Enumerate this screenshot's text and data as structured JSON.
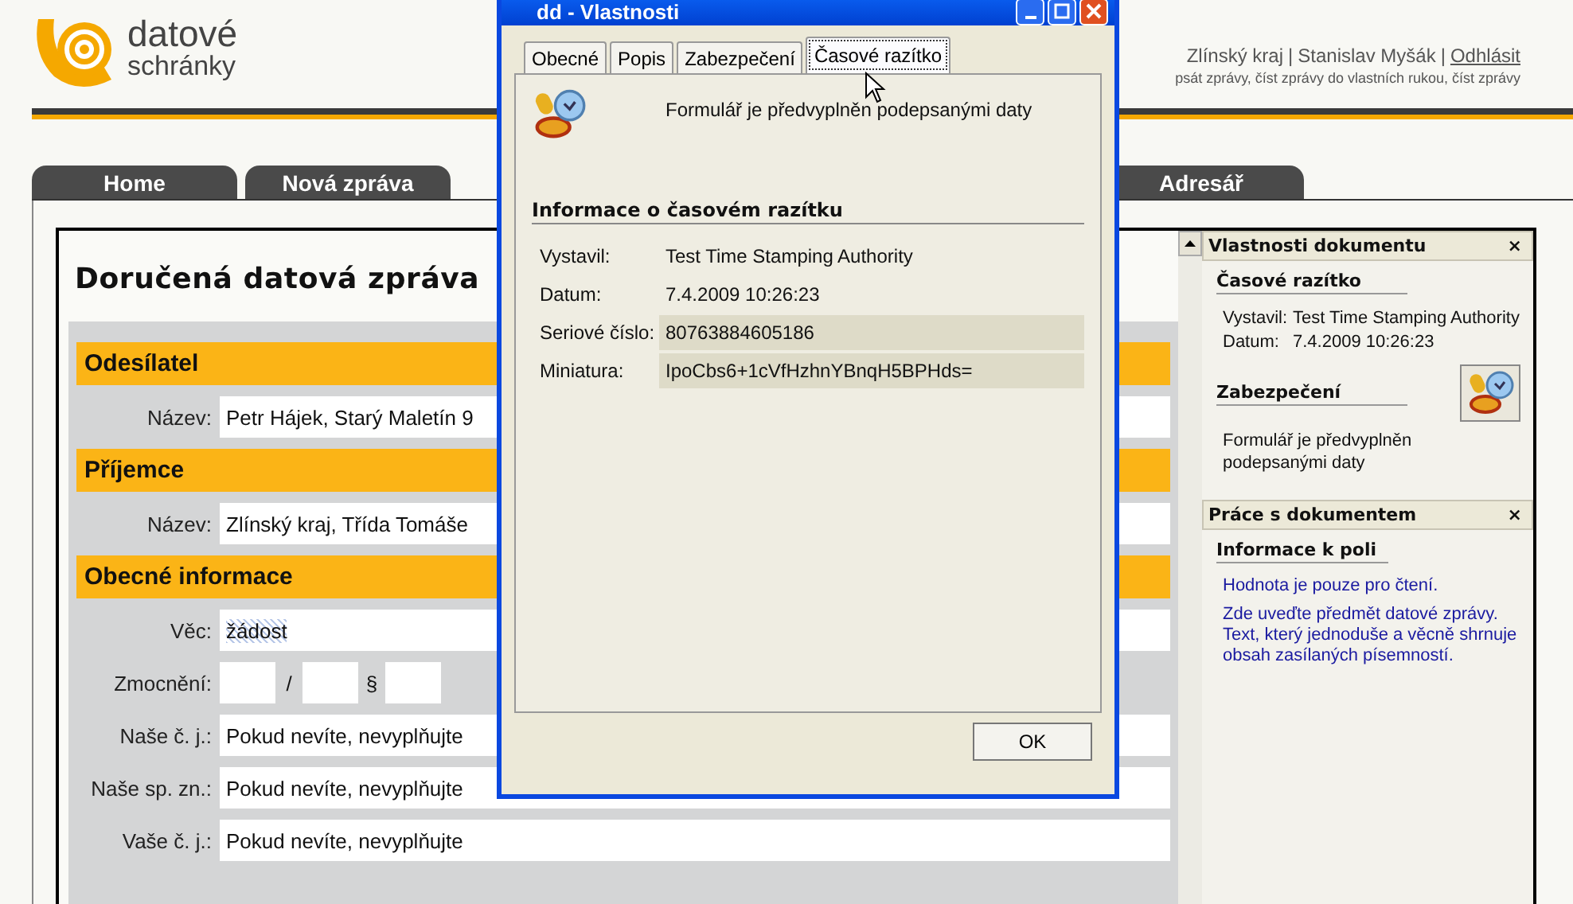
{
  "header": {
    "logo": {
      "line_1": "datové",
      "line_2": "schránky"
    },
    "user_bar": [
      {
        "kind": "text",
        "text": "Zlínský kraj"
      },
      {
        "kind": "separator",
        "text": "|"
      },
      {
        "kind": "text",
        "text": "Stanislav Myšák"
      },
      {
        "kind": "separator",
        "text": "|"
      },
      {
        "kind": "link",
        "text": "Odhlásit"
      }
    ],
    "permissions": "psát zprávy, číst zprávy do vlastních rukou, číst zprávy"
  },
  "nav_tabs": [
    {
      "label": "Home"
    },
    {
      "label": "Nová zpráva"
    },
    {
      "label": "Adresář"
    }
  ],
  "form": {
    "title": "Doručená datová zpráva",
    "sections": [
      {
        "title": "Odesílatel",
        "rows": [
          {
            "kind": "field",
            "label": "Název:",
            "value": "Petr Hájek, Starý Maletín 9",
            "highlighted": false
          }
        ]
      },
      {
        "title": "Příjemce",
        "rows": [
          {
            "kind": "field",
            "label": "Název:",
            "value": "Zlínský kraj, Třída Tomáše",
            "highlighted": false
          }
        ]
      },
      {
        "title": "Obecné informace",
        "rows": [
          {
            "kind": "field",
            "label": "Věc:",
            "value": "žádost",
            "highlighted": true
          },
          {
            "kind": "authorization",
            "label": "Zmocnění:",
            "separator_1": "/",
            "separator_2": "§"
          },
          {
            "kind": "field",
            "label": "Naše č. j.:",
            "value": "Pokud nevíte, nevyplňujte",
            "highlighted": false
          },
          {
            "kind": "field",
            "label": "Naše sp. zn.:",
            "value": "Pokud nevíte, nevyplňujte",
            "highlighted": false
          },
          {
            "kind": "field",
            "label": "Vaše č. j.:",
            "value": "Pokud nevíte, nevyplňujte",
            "highlighted": false
          }
        ]
      }
    ]
  },
  "task_pane": [
    {
      "title": "Vlastnosti dokumentu",
      "close": "×",
      "blocks": [
        {
          "kind": "info",
          "heading": "Časové razítko",
          "rows": [
            {
              "label": "Vystavil:",
              "value": "Test Time Stamping Authority"
            },
            {
              "label": "Datum:",
              "value": "7.4.2009 10:26:23"
            }
          ]
        },
        {
          "kind": "security",
          "heading": "Zabezpečení",
          "text": "Formulář je předvyplněn podepsanými daty"
        }
      ]
    },
    {
      "title": "Práce s dokumentem",
      "close": "×",
      "blocks": [
        {
          "kind": "notes",
          "heading": "Informace k poli",
          "notes": [
            "Hodnota je pouze pro čtení.",
            "Zde uveďte předmět datové zprávy. Text, který jednoduše a věcně shrnuje obsah zasílaných písemností."
          ]
        }
      ]
    }
  ],
  "dialog": {
    "title": "dd - Vlastnosti",
    "tabs": [
      {
        "label": "Obecné",
        "selected": false
      },
      {
        "label": "Popis",
        "selected": false
      },
      {
        "label": "Zabezpečení",
        "selected": false
      },
      {
        "label": "Časové razítko",
        "selected": true
      }
    ],
    "message": "Formulář je předvyplněn podepsanými daty",
    "section_title": "Informace o časovém razítku",
    "rows": [
      {
        "label": "Vystavil:",
        "value": "Test Time Stamping Authority",
        "shaded": false
      },
      {
        "label": "Datum:",
        "value": "7.4.2009 10:26:23",
        "shaded": false
      },
      {
        "label": "Seriové číslo:",
        "value": "80763884605186",
        "shaded": true
      },
      {
        "label": "Miniatura:",
        "value": "IpoCbs6+1cVfHzhnYBnqH5BPHds=",
        "shaded": true
      }
    ],
    "ok_button": "OK"
  }
}
